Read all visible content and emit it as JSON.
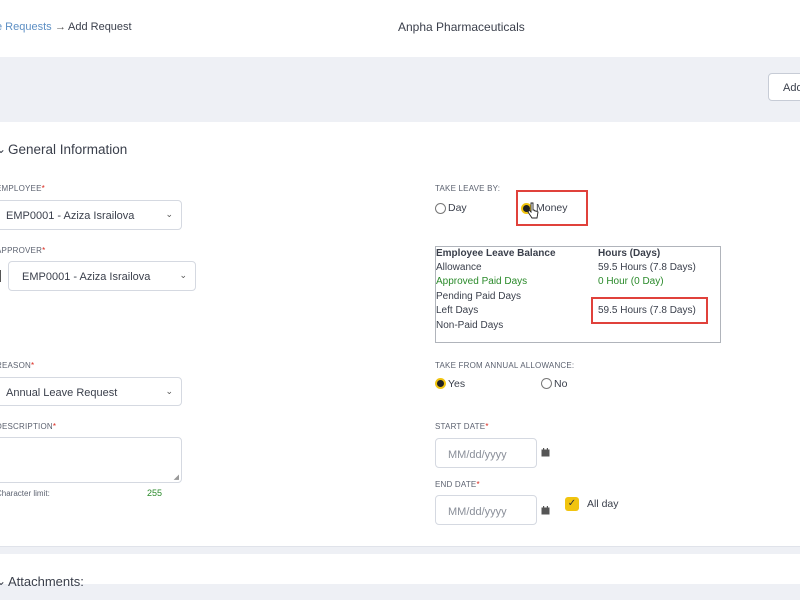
{
  "breadcrumb": {
    "parent": "e Requests",
    "separator": "→",
    "current": "Add Request"
  },
  "header": {
    "company": "Anpha Pharmaceuticals"
  },
  "toolbar": {
    "add_label": "Add"
  },
  "section": {
    "title": "General Information",
    "chevron": "⌄"
  },
  "form": {
    "employee": {
      "label": "EMPLOYEE",
      "value": "EMP0001 - Aziza Israilova"
    },
    "approver": {
      "label": "APPROVER",
      "value": "EMP0001 - Aziza Israilova"
    },
    "reason": {
      "label": "REASON",
      "value": "Annual Leave Request"
    },
    "description": {
      "label": "DESCRIPTION",
      "char_limit_label": "Character limit:",
      "char_limit_value": "255"
    },
    "take_leave_by": {
      "label": "TAKE LEAVE BY:",
      "options": [
        "Day",
        "Money"
      ],
      "selected": "Money"
    },
    "balance": {
      "header_left": "Employee Leave Balance",
      "header_right": "Hours (Days)",
      "rows": [
        {
          "label": "Allowance",
          "value": "59.5 Hours (7.8 Days)"
        },
        {
          "label": "Approved Paid Days",
          "value": "0 Hour (0 Day)"
        },
        {
          "label": "Pending Paid Days",
          "value": ""
        },
        {
          "label": "Left Days",
          "value": "59.5 Hours (7.8 Days)"
        },
        {
          "label": "Non-Paid Days",
          "value": ""
        }
      ]
    },
    "take_from_annual": {
      "label": "TAKE FROM ANNUAL ALLOWANCE:",
      "options": [
        "Yes",
        "No"
      ],
      "selected": "Yes"
    },
    "start_date": {
      "label": "START DATE",
      "placeholder": "MM/dd/yyyy"
    },
    "end_date": {
      "label": "END DATE",
      "placeholder": "MM/dd/yyyy"
    },
    "all_day": {
      "label": "All day",
      "checked": true
    }
  },
  "attachments": {
    "title": "Attachments:"
  },
  "icons": {
    "chevron_down": "⌄",
    "calendar": "calendar-icon",
    "check": "✓"
  },
  "colors": {
    "accent_yellow": "#f1c40f",
    "required_red": "#d9261c",
    "highlight_red": "#e0413b",
    "green": "#2a8a2a",
    "link_blue": "#5d8fc4"
  }
}
